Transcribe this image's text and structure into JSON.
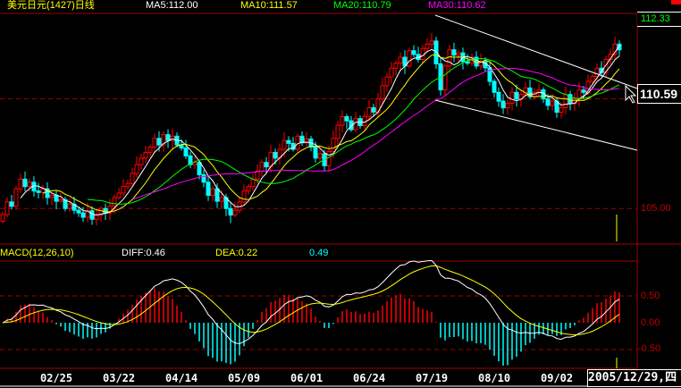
{
  "header": {
    "title": "美元日元(1427)日线",
    "ma5": "MA5:112.00",
    "ma10": "MA10:111.57",
    "ma20": "MA20:110.79",
    "ma30": "MA30:110.62"
  },
  "macd_header": {
    "name": "MACD(12,26,10)",
    "diff": "DIFF:0.46",
    "dea": "DEA:0.22",
    "macd": "0.49"
  },
  "price_axis": {
    "top_label": "112.33",
    "cursor_label": "110.59",
    "label_105": "105.00"
  },
  "macd_axis": {
    "pos": "0.50",
    "zero": "0.00",
    "neg": "-0.50"
  },
  "date_axis": [
    "02/25",
    "03/22",
    "04/14",
    "05/09",
    "06/01",
    "06/24",
    "07/19",
    "08/10",
    "09/02"
  ],
  "cursor_date": "2005/12/29,四",
  "colors": {
    "up": "#ff0000",
    "down": "#00ffff",
    "ma5": "#ffffff",
    "ma10": "#ffff00",
    "ma20": "#00ff00",
    "ma30": "#ff00ff",
    "grid": "#a00000"
  },
  "chart_data": {
    "type": "candlestick",
    "title": "美元日元(1427)日线",
    "ylim": [
      103.5,
      113.9
    ],
    "macd_ylim": [
      -0.85,
      1.1
    ],
    "ma_periods": [
      5,
      10,
      20,
      30
    ],
    "macd_params": [
      12,
      26,
      10
    ],
    "close": [
      104.72,
      105.3,
      105.1,
      105.9,
      106.34,
      106.0,
      106.2,
      105.8,
      105.73,
      105.9,
      105.5,
      105.6,
      105.33,
      105.4,
      105.0,
      105.2,
      104.92,
      104.8,
      104.6,
      104.9,
      104.51,
      104.7,
      105.0,
      104.8,
      105.12,
      105.5,
      105.7,
      106.0,
      106.14,
      106.6,
      107.0,
      107.3,
      107.56,
      107.8,
      108.2,
      107.9,
      108.37,
      108.1,
      108.3,
      107.9,
      107.76,
      107.4,
      107.0,
      107.1,
      106.54,
      106.2,
      105.6,
      105.9,
      105.33,
      105.5,
      105.0,
      104.7,
      104.92,
      105.3,
      105.8,
      106.0,
      106.34,
      106.7,
      107.1,
      106.9,
      107.56,
      107.3,
      107.7,
      108.1,
      107.97,
      107.7,
      108.3,
      108.0,
      108.17,
      107.8,
      107.3,
      107.5,
      106.95,
      107.6,
      108.2,
      108.8,
      109.19,
      109.0,
      108.6,
      109.1,
      108.78,
      109.2,
      109.6,
      109.4,
      110.0,
      110.6,
      111.0,
      111.4,
      111.63,
      111.9,
      111.5,
      112.2,
      112.03,
      111.8,
      112.3,
      112.5,
      112.64,
      111.6,
      110.41,
      111.5,
      112.24,
      112.0,
      112.1,
      111.7,
      111.63,
      111.9,
      111.5,
      111.7,
      111.42,
      110.8,
      110.3,
      109.9,
      109.59,
      109.8,
      110.3,
      110.0,
      110.2,
      110.5,
      110.1,
      110.3,
      110.41,
      110.0,
      109.7,
      109.9,
      109.39,
      109.6,
      110.2,
      109.8,
      110.0,
      110.4,
      110.3,
      110.8,
      111.02,
      111.4,
      111.2,
      111.8,
      112.03,
      112.5,
      112.24
    ]
  }
}
